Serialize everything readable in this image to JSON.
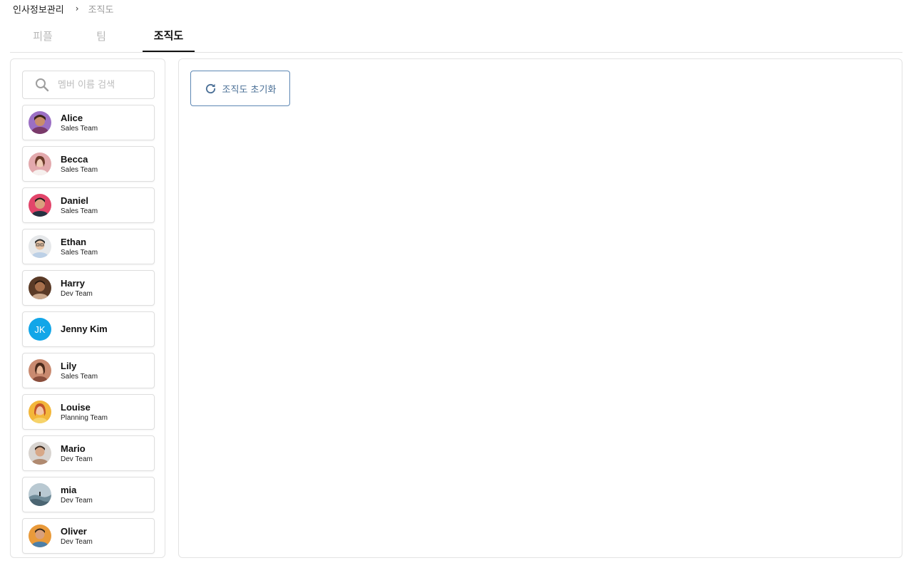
{
  "breadcrumb": {
    "root": "인사정보관리",
    "separator": "›",
    "current": "조직도"
  },
  "tabs": [
    {
      "label": "피플",
      "active": false
    },
    {
      "label": "팀",
      "active": false
    },
    {
      "label": "조직도",
      "active": true
    }
  ],
  "search": {
    "placeholder": "멤버 이름 검색",
    "value": "",
    "icon": "search-icon"
  },
  "members": [
    {
      "name": "Alice",
      "team": "Sales Team"
    },
    {
      "name": "Becca",
      "team": "Sales Team"
    },
    {
      "name": "Daniel",
      "team": "Sales Team"
    },
    {
      "name": "Ethan",
      "team": "Sales Team"
    },
    {
      "name": "Harry",
      "team": "Dev Team"
    },
    {
      "name": "Jenny Kim",
      "team": "",
      "initials": "JK"
    },
    {
      "name": "Lily",
      "team": "Sales Team"
    },
    {
      "name": "Louise",
      "team": "Planning Team"
    },
    {
      "name": "Mario",
      "team": "Dev Team"
    },
    {
      "name": "mia",
      "team": "Dev Team"
    },
    {
      "name": "Oliver",
      "team": "Dev Team"
    }
  ],
  "reset_button": {
    "label": "조직도 초기화",
    "icon": "refresh-icon"
  },
  "colors": {
    "accent": "#5d87b4",
    "jk_avatar": "#12a6e8",
    "active_tab": "#111111",
    "inactive_tab": "#b8b8b8"
  }
}
